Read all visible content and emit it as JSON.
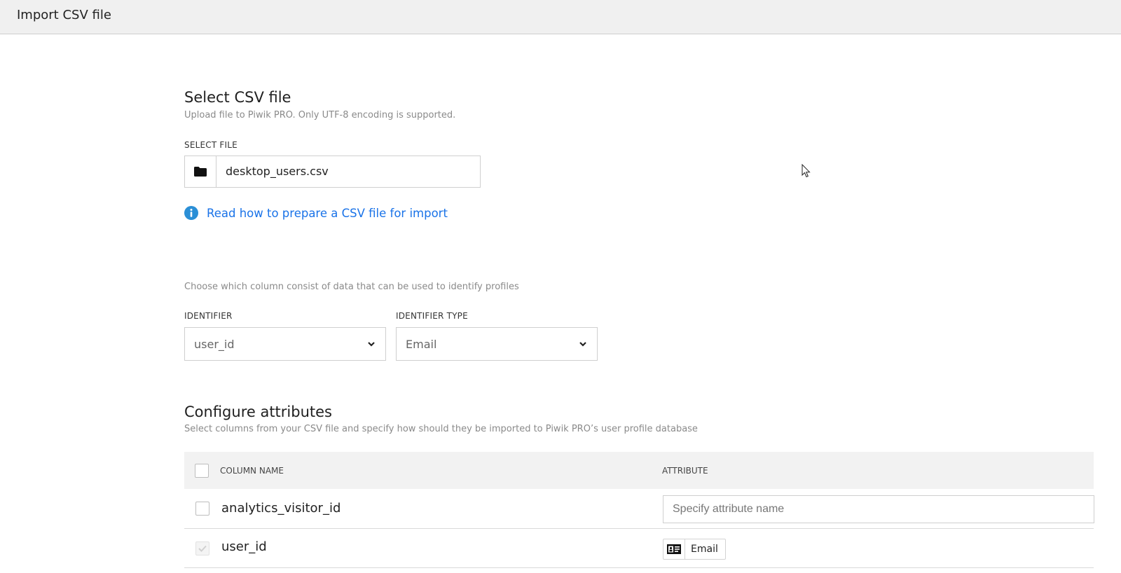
{
  "header": {
    "title": "Import CSV file"
  },
  "select_file": {
    "heading": "Select CSV file",
    "description": "Upload file to Piwik PRO. Only UTF-8 encoding is supported.",
    "field_label": "SELECT FILE",
    "file_name": "desktop_users.csv",
    "help_link": "Read how to prepare a CSV file for import",
    "folder_icon": "folder-icon",
    "info_icon": "info-icon"
  },
  "identifier": {
    "description": "Choose which column consist of data that can be used to identify profiles",
    "identifier_label": "IDENTIFIER",
    "identifier_value": "user_id",
    "type_label": "IDENTIFIER TYPE",
    "type_value": "Email"
  },
  "attributes": {
    "heading": "Configure attributes",
    "description": "Select columns from your CSV file and specify how should they be imported to Piwik PRO’s user profile database",
    "columns": {
      "name": "COLUMN NAME",
      "attribute": "ATTRIBUTE"
    },
    "rows": [
      {
        "name": "analytics_visitor_id",
        "checked": false,
        "attribute_placeholder": "Specify attribute name"
      },
      {
        "name": "user_id",
        "checked": true,
        "disabled": true,
        "attribute": "Email",
        "attribute_icon": "id-card-icon"
      }
    ]
  },
  "colors": {
    "link": "#1a73e8",
    "info_icon": "#2b8fd6",
    "header_bg": "#f0f0f0",
    "table_head_bg": "#f2f2f2"
  }
}
